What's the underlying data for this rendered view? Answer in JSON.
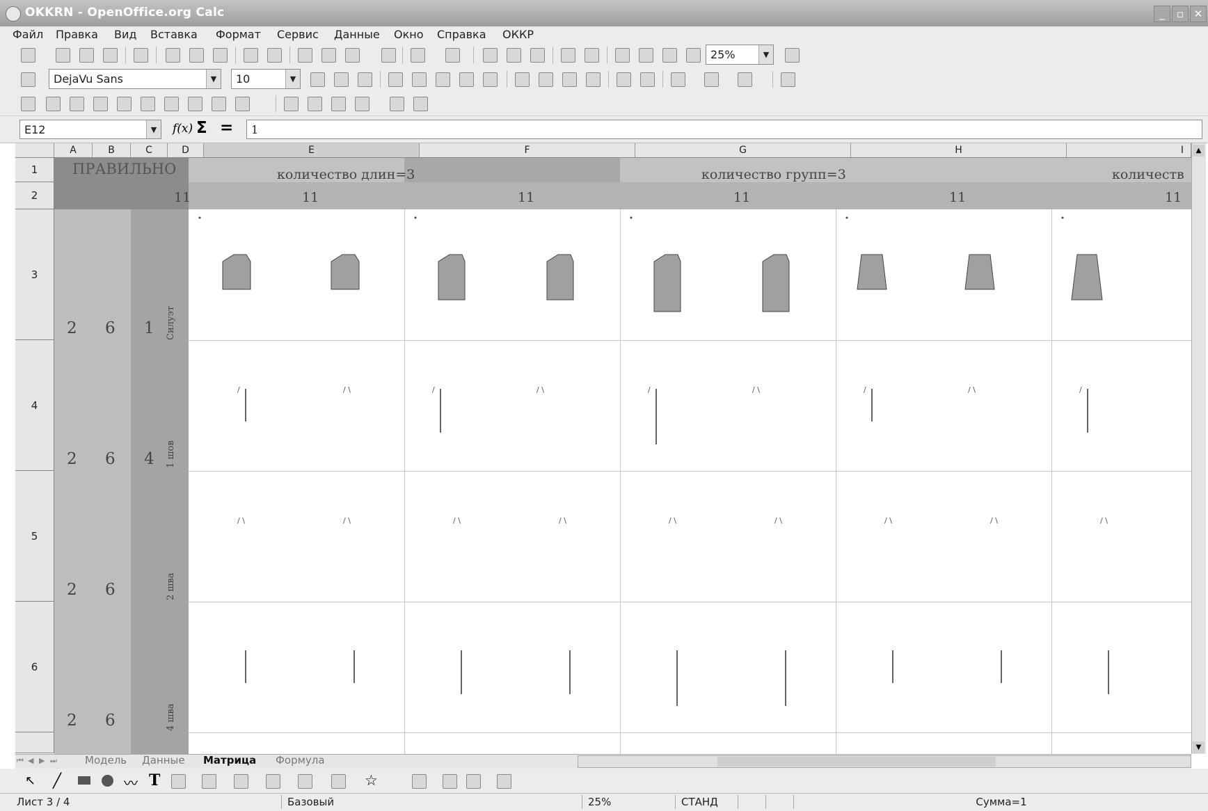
{
  "window": {
    "title": "OKKRN - OpenOffice.org Calc"
  },
  "menu": [
    "Файл",
    "Правка",
    "Вид",
    "Вставка",
    "Формат",
    "Сервис",
    "Данные",
    "Окно",
    "Справка",
    "ОККР"
  ],
  "toolbar": {
    "zoom": "25%",
    "font_name": "DejaVu Sans",
    "font_size": "10"
  },
  "formula_bar": {
    "cell_ref": "E12",
    "value": "1",
    "fx": "f(x)",
    "sigma": "Σ",
    "equals": "="
  },
  "columns": [
    "A",
    "B",
    "C",
    "D",
    "E",
    "F",
    "G",
    "H",
    "I"
  ],
  "rows": [
    "1",
    "2",
    "3",
    "4",
    "5",
    "6"
  ],
  "sheet": {
    "r1_left": "ПРАВИЛЬНО",
    "r1_len": "количество длин=3",
    "r1_groups": "количество групп=3",
    "r1_cut": "количеств",
    "r2_vals": [
      "11",
      "11",
      "11",
      "11",
      "11",
      "11"
    ],
    "left_rows": [
      {
        "a": "2",
        "b": "6",
        "c": "1",
        "d": "Силуэт"
      },
      {
        "a": "2",
        "b": "6",
        "c": "4",
        "d": "1 шов"
      },
      {
        "a": "2",
        "b": "6",
        "c": "",
        "d": "2 шва"
      },
      {
        "a": "2",
        "b": "6",
        "c": "",
        "d": "4 шва"
      }
    ],
    "dot": "·",
    "seam_mark_single": "/",
    "seam_mark_double": "/ \\"
  },
  "sheet_tabs": [
    "Модель",
    "Данные",
    "Матрица",
    "Формула"
  ],
  "active_tab": "Матрица",
  "status": {
    "sheet": "Лист 3 / 4",
    "style": "Базовый",
    "zoom": "25%",
    "mode": "СТАНД",
    "sum": "Сумма=1"
  },
  "colors": {
    "header_dark": "#8c8c8c",
    "header_mid": "#b0b0b0",
    "band": "#bdbdbd",
    "shape": "#a0a0a0"
  }
}
